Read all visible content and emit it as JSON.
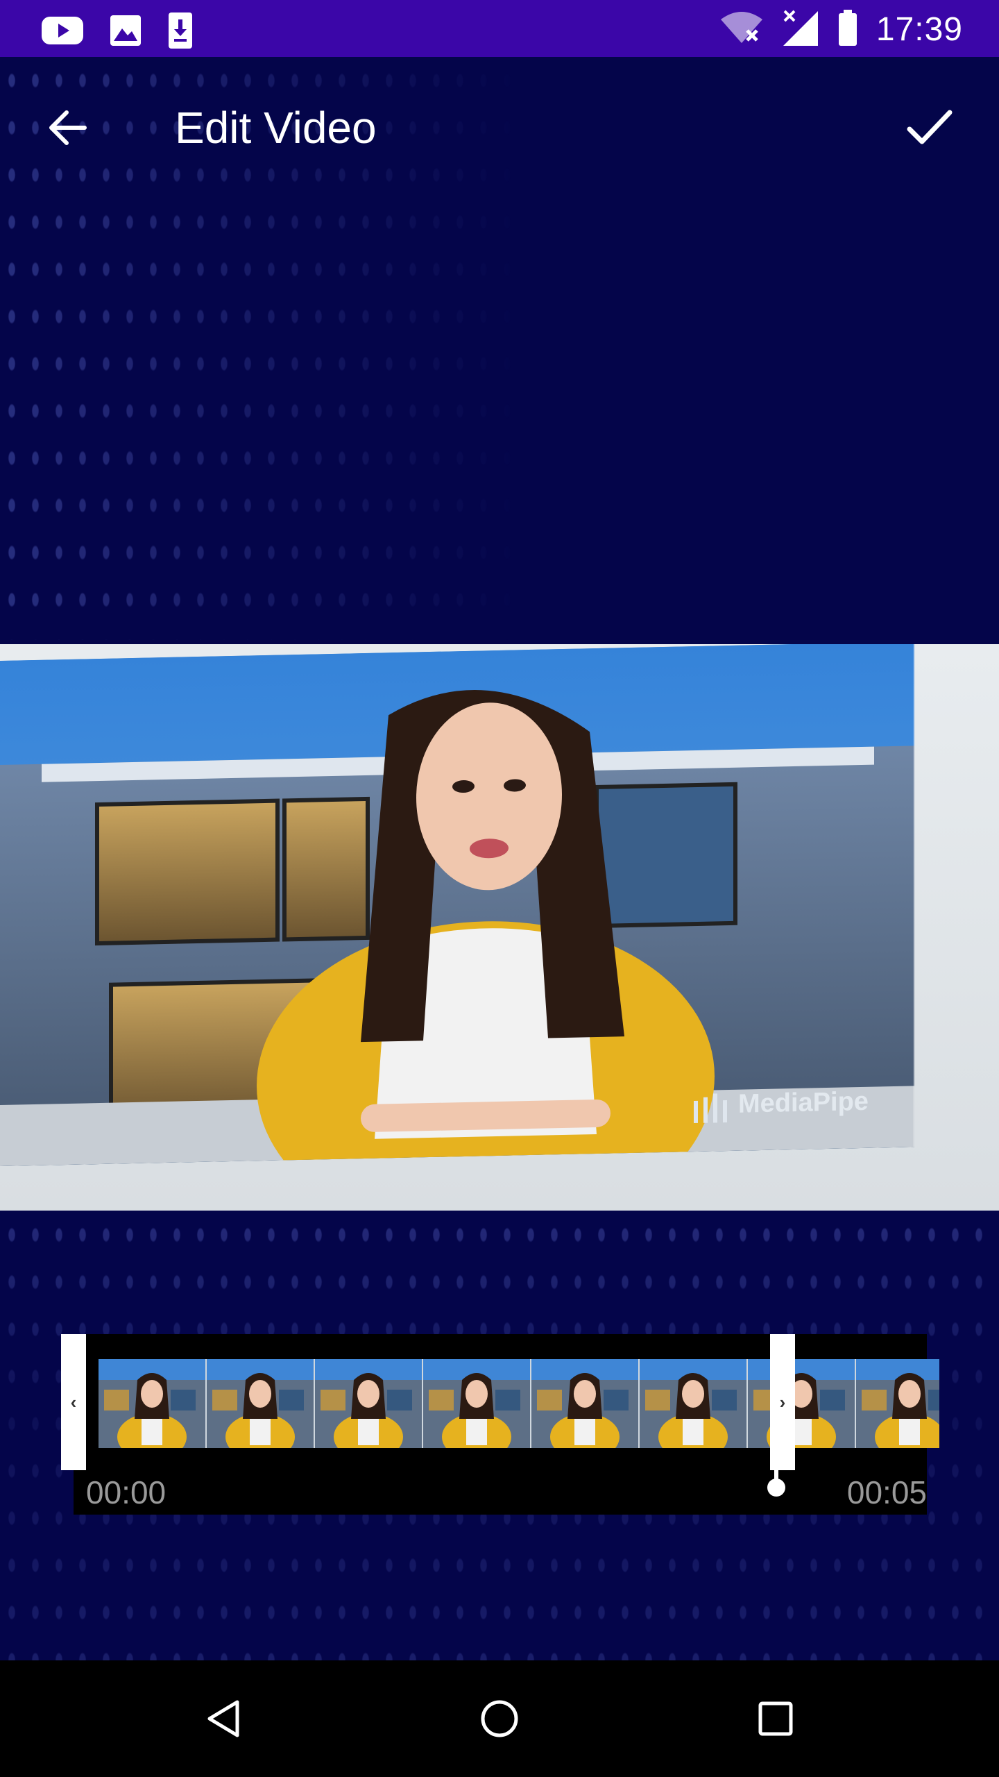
{
  "status_bar": {
    "time": "17:39",
    "left_icons": [
      "youtube-icon",
      "image-icon",
      "download-icon"
    ],
    "right_icons": [
      "wifi-icon",
      "signal-icon",
      "battery-icon"
    ],
    "background_color": "#3b06a8"
  },
  "app_bar": {
    "title": "Edit Video",
    "back_icon": "arrow-back-icon",
    "confirm_icon": "check-icon"
  },
  "video_preview": {
    "watermark": "MediaPipe"
  },
  "timeline": {
    "start_time": "00:00",
    "end_time": "00:05",
    "thumbnail_count": 8,
    "handle_left_glyph": "‹",
    "handle_right_glyph": "›"
  },
  "nav_bar": {
    "buttons": [
      "nav-back-icon",
      "nav-home-icon",
      "nav-recents-icon"
    ]
  },
  "colors": {
    "background": "#04054a",
    "status_bar": "#3b06a8",
    "timeline_bg": "#000000",
    "time_label": "#9a9a9a"
  }
}
